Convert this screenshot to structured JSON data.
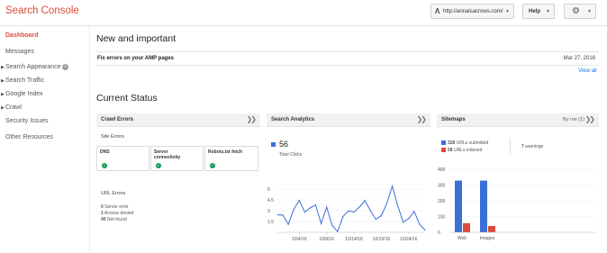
{
  "header": {
    "app_title": "Search Console",
    "site_favicon": "Λ",
    "site_url": "http://annalsacrows.com/",
    "help_label": "Help",
    "settings_icon": "gear-icon"
  },
  "sidebar": {
    "items": [
      {
        "label": "Dashboard",
        "active": true,
        "expandable": false
      },
      {
        "label": "Messages",
        "expandable": false
      },
      {
        "label": "Search Appearance",
        "expandable": true,
        "info": true
      },
      {
        "label": "Search Traffic",
        "expandable": true
      },
      {
        "label": "Google Index",
        "expandable": true
      },
      {
        "label": "Crawl",
        "expandable": true
      },
      {
        "label": "Security Issues",
        "expandable": false
      },
      {
        "label": "Other Resources",
        "expandable": false
      }
    ],
    "info_glyph": "i"
  },
  "new_important": {
    "title": "New and important",
    "notice": "Fix errors on your AMP pages",
    "date": "Mar 27, 2016",
    "view_all": "View all"
  },
  "current_status": {
    "title": "Current Status",
    "crawl_errors": {
      "title": "Crawl Errors",
      "site_errors_label": "Site Errors",
      "cells": [
        "DNS",
        "Server connectivity",
        "Robots.txt fetch"
      ],
      "url_errors_label": "URL Errors",
      "url_errors": [
        {
          "count": "0",
          "label": "Server error"
        },
        {
          "count": "1",
          "label": "Access denied"
        },
        {
          "count": "40",
          "label": "Not found"
        }
      ]
    },
    "search_analytics": {
      "title": "Search Analytics",
      "clicks_value": "56",
      "clicks_label": "Total Clicks"
    },
    "sitemaps": {
      "title": "Sitemaps",
      "by_me": "By me (1)",
      "submitted_count": "328",
      "submitted_label": "URLs submitted",
      "indexed_count": "58",
      "indexed_label": "URLs indexed",
      "warnings_count": "7",
      "warnings_label": "warnings"
    }
  },
  "colors": {
    "accent": "#dd4b39",
    "blue": "#3b6fd8",
    "red": "#dd4b39",
    "green": "#0f9d58"
  },
  "chart_data": [
    {
      "type": "line",
      "yticks": [
        1.5,
        3,
        4.5,
        6
      ],
      "ylim": [
        0,
        7
      ],
      "xticks": [
        "10/4/16",
        "10/9/16",
        "10/14/16",
        "10/19/16",
        "10/24/16"
      ],
      "x": [
        "9/30/16",
        "10/1/16",
        "10/2/16",
        "10/3/16",
        "10/4/16",
        "10/5/16",
        "10/6/16",
        "10/7/16",
        "10/8/16",
        "10/9/16",
        "10/10/16",
        "10/11/16",
        "10/12/16",
        "10/13/16",
        "10/14/16",
        "10/15/16",
        "10/16/16",
        "10/17/16",
        "10/18/16",
        "10/19/16",
        "10/20/16",
        "10/21/16",
        "10/22/16",
        "10/23/16",
        "10/24/16",
        "10/25/16",
        "10/26/16",
        "10/27/16"
      ],
      "series": [
        {
          "values": [
            2.4,
            2.4,
            1.1,
            3.2,
            4.4,
            2.8,
            3.4,
            3.8,
            1.2,
            3.5,
            1.0,
            0.1,
            2.2,
            3.0,
            2.8,
            3.5,
            4.4,
            3.0,
            1.8,
            2.3,
            4.0,
            6.4,
            3.7,
            1.4,
            1.9,
            2.9,
            1.1,
            0.3
          ]
        }
      ]
    },
    {
      "type": "bar",
      "categories": [
        "Web",
        "Images"
      ],
      "yticks": [
        0,
        100,
        200,
        300,
        400
      ],
      "ylim": [
        0,
        400
      ],
      "series": [
        {
          "name": "URLs submitted",
          "values": [
            328,
            328
          ]
        },
        {
          "name": "URLs indexed",
          "values": [
            58,
            40
          ]
        }
      ]
    }
  ]
}
